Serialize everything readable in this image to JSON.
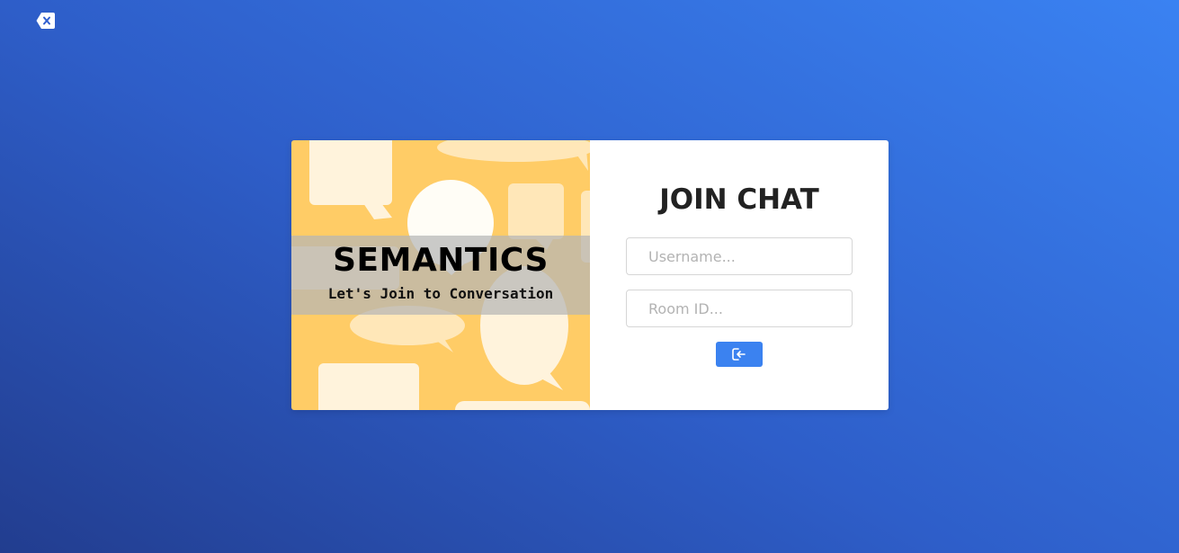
{
  "close_button": {
    "icon": "backspace-x-icon",
    "color": "#ffffff"
  },
  "brand": {
    "title": "SEMANTICS",
    "subtitle": "Let's Join to Conversation",
    "background_color": "#ffcc66"
  },
  "form": {
    "title": "JOIN CHAT",
    "username": {
      "placeholder": "Username...",
      "value": ""
    },
    "room_id": {
      "placeholder": "Room ID...",
      "value": ""
    },
    "submit": {
      "icon": "sign-in-icon",
      "color": "#3b82f0"
    }
  },
  "colors": {
    "background_start": "#223d8f",
    "background_end": "#3a82f2",
    "panel": "#ffffff"
  }
}
